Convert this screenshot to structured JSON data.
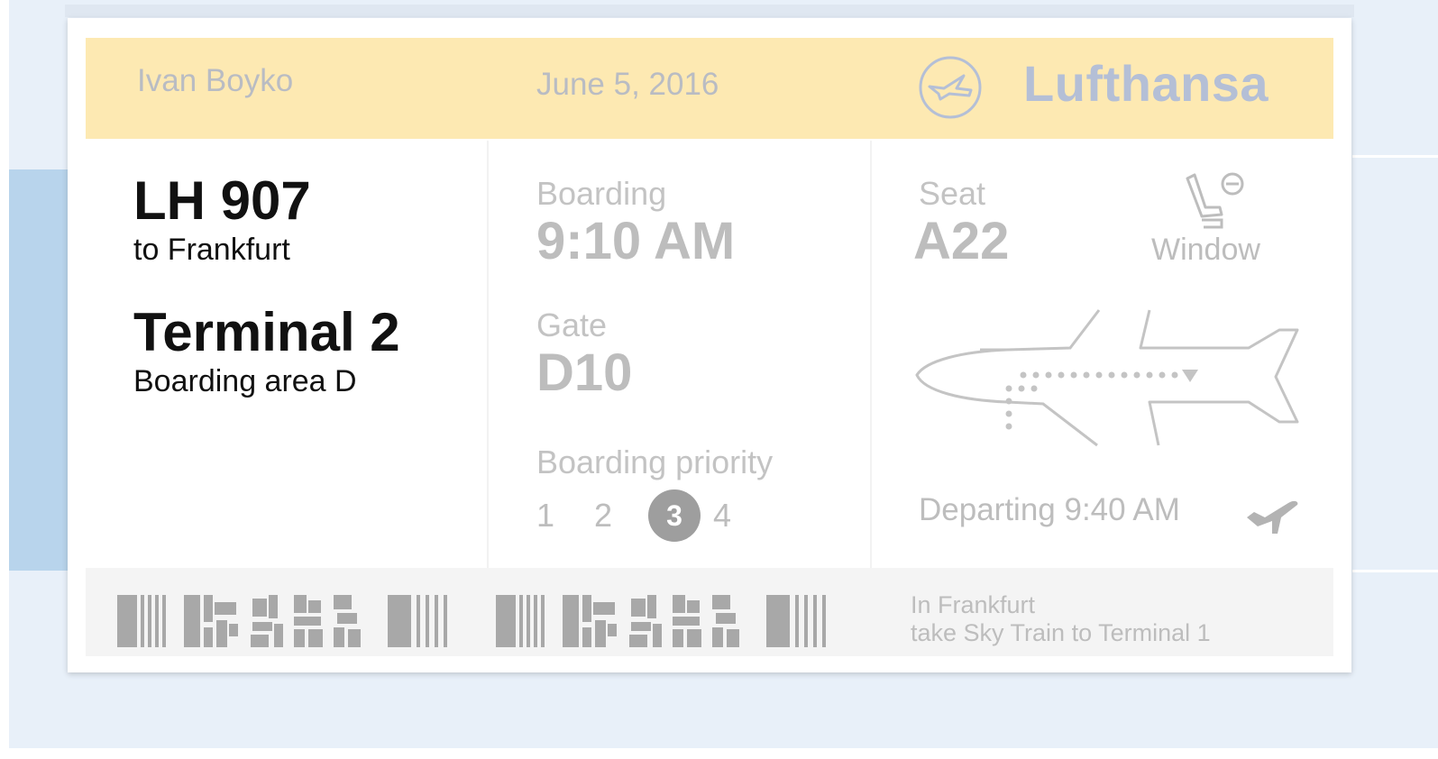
{
  "passenger": {
    "name": "Ivan Boyko"
  },
  "flight_date": "June 5, 2016",
  "airline": {
    "name": "Lufthansa",
    "logo_icon": "lufthansa-crane-icon"
  },
  "flight": {
    "number": "LH 907",
    "destination": "to Frankfurt",
    "terminal": "Terminal 2",
    "boarding_area": "Boarding area D"
  },
  "boarding": {
    "label": "Boarding",
    "time": "9:10 AM",
    "gate_label": "Gate",
    "gate": "D10",
    "priority_label": "Boarding priority",
    "priorities": [
      "1",
      "2",
      "3",
      "4"
    ],
    "selected_priority": "3"
  },
  "seat": {
    "label": "Seat",
    "number": "A22",
    "type": "Window",
    "icon": "window-seat-icon"
  },
  "departure": {
    "text": "Departing 9:40 AM",
    "icon": "departure-plane-icon"
  },
  "note": {
    "line1": "In Frankfurt",
    "line2": "take Sky Train to Terminal 1"
  },
  "colors": {
    "header_bg": "#fde9b2",
    "brand": "#b4bfd6",
    "muted_text": "#bdbdbd",
    "primary_text": "#111111",
    "selected_priority_bg": "#9e9e9e",
    "page_bg": "#e8f0f9",
    "accent_strip": "#b8d4ec"
  }
}
